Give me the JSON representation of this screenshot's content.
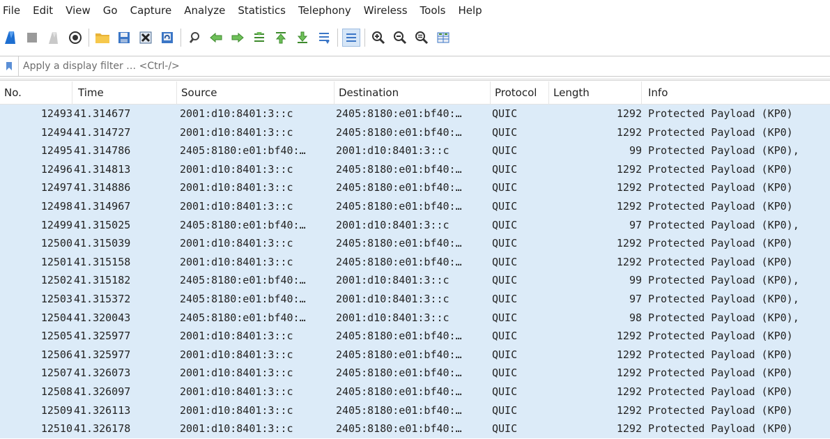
{
  "menu": [
    "File",
    "Edit",
    "View",
    "Go",
    "Capture",
    "Analyze",
    "Statistics",
    "Telephony",
    "Wireless",
    "Tools",
    "Help"
  ],
  "toolbar_icons": [
    "start-capture-icon",
    "stop-capture-icon",
    "restart-capture-icon",
    "capture-options-icon",
    "separator",
    "open-file-icon",
    "save-file-icon",
    "close-file-icon",
    "reload-file-icon",
    "separator",
    "find-packet-icon",
    "go-back-icon",
    "go-forward-icon",
    "go-to-packet-icon",
    "go-first-icon",
    "go-last-icon",
    "autoscroll-icon",
    "separator",
    "colorize-icon",
    "separator",
    "zoom-in-icon",
    "zoom-out-icon",
    "normal-size-icon",
    "resize-columns-icon"
  ],
  "filter": {
    "placeholder": "Apply a display filter … <Ctrl-/>",
    "value": ""
  },
  "columns": [
    "No.",
    "Time",
    "Source",
    "Destination",
    "Protocol",
    "Length",
    "Info"
  ],
  "colors": {
    "row_bg": "#dcebf8",
    "accent": "#1e6fd1"
  },
  "packets": [
    {
      "no": "12493",
      "time": "41.314677",
      "source": "2001:d10:8401:3::c",
      "destination": "2405:8180:e01:bf40:…",
      "protocol": "QUIC",
      "length": "1292",
      "info": "Protected Payload (KP0)"
    },
    {
      "no": "12494",
      "time": "41.314727",
      "source": "2001:d10:8401:3::c",
      "destination": "2405:8180:e01:bf40:…",
      "protocol": "QUIC",
      "length": "1292",
      "info": "Protected Payload (KP0)"
    },
    {
      "no": "12495",
      "time": "41.314786",
      "source": "2405:8180:e01:bf40:…",
      "destination": "2001:d10:8401:3::c",
      "protocol": "QUIC",
      "length": "99",
      "info": "Protected Payload (KP0),"
    },
    {
      "no": "12496",
      "time": "41.314813",
      "source": "2001:d10:8401:3::c",
      "destination": "2405:8180:e01:bf40:…",
      "protocol": "QUIC",
      "length": "1292",
      "info": "Protected Payload (KP0)"
    },
    {
      "no": "12497",
      "time": "41.314886",
      "source": "2001:d10:8401:3::c",
      "destination": "2405:8180:e01:bf40:…",
      "protocol": "QUIC",
      "length": "1292",
      "info": "Protected Payload (KP0)"
    },
    {
      "no": "12498",
      "time": "41.314967",
      "source": "2001:d10:8401:3::c",
      "destination": "2405:8180:e01:bf40:…",
      "protocol": "QUIC",
      "length": "1292",
      "info": "Protected Payload (KP0)"
    },
    {
      "no": "12499",
      "time": "41.315025",
      "source": "2405:8180:e01:bf40:…",
      "destination": "2001:d10:8401:3::c",
      "protocol": "QUIC",
      "length": "97",
      "info": "Protected Payload (KP0),"
    },
    {
      "no": "12500",
      "time": "41.315039",
      "source": "2001:d10:8401:3::c",
      "destination": "2405:8180:e01:bf40:…",
      "protocol": "QUIC",
      "length": "1292",
      "info": "Protected Payload (KP0)"
    },
    {
      "no": "12501",
      "time": "41.315158",
      "source": "2001:d10:8401:3::c",
      "destination": "2405:8180:e01:bf40:…",
      "protocol": "QUIC",
      "length": "1292",
      "info": "Protected Payload (KP0)"
    },
    {
      "no": "12502",
      "time": "41.315182",
      "source": "2405:8180:e01:bf40:…",
      "destination": "2001:d10:8401:3::c",
      "protocol": "QUIC",
      "length": "99",
      "info": "Protected Payload (KP0),"
    },
    {
      "no": "12503",
      "time": "41.315372",
      "source": "2405:8180:e01:bf40:…",
      "destination": "2001:d10:8401:3::c",
      "protocol": "QUIC",
      "length": "97",
      "info": "Protected Payload (KP0),"
    },
    {
      "no": "12504",
      "time": "41.320043",
      "source": "2405:8180:e01:bf40:…",
      "destination": "2001:d10:8401:3::c",
      "protocol": "QUIC",
      "length": "98",
      "info": "Protected Payload (KP0),"
    },
    {
      "no": "12505",
      "time": "41.325977",
      "source": "2001:d10:8401:3::c",
      "destination": "2405:8180:e01:bf40:…",
      "protocol": "QUIC",
      "length": "1292",
      "info": "Protected Payload (KP0)"
    },
    {
      "no": "12506",
      "time": "41.325977",
      "source": "2001:d10:8401:3::c",
      "destination": "2405:8180:e01:bf40:…",
      "protocol": "QUIC",
      "length": "1292",
      "info": "Protected Payload (KP0)"
    },
    {
      "no": "12507",
      "time": "41.326073",
      "source": "2001:d10:8401:3::c",
      "destination": "2405:8180:e01:bf40:…",
      "protocol": "QUIC",
      "length": "1292",
      "info": "Protected Payload (KP0)"
    },
    {
      "no": "12508",
      "time": "41.326097",
      "source": "2001:d10:8401:3::c",
      "destination": "2405:8180:e01:bf40:…",
      "protocol": "QUIC",
      "length": "1292",
      "info": "Protected Payload (KP0)"
    },
    {
      "no": "12509",
      "time": "41.326113",
      "source": "2001:d10:8401:3::c",
      "destination": "2405:8180:e01:bf40:…",
      "protocol": "QUIC",
      "length": "1292",
      "info": "Protected Payload (KP0)"
    },
    {
      "no": "12510",
      "time": "41.326178",
      "source": "2001:d10:8401:3::c",
      "destination": "2405:8180:e01:bf40:…",
      "protocol": "QUIC",
      "length": "1292",
      "info": "Protected Payload (KP0)"
    }
  ]
}
